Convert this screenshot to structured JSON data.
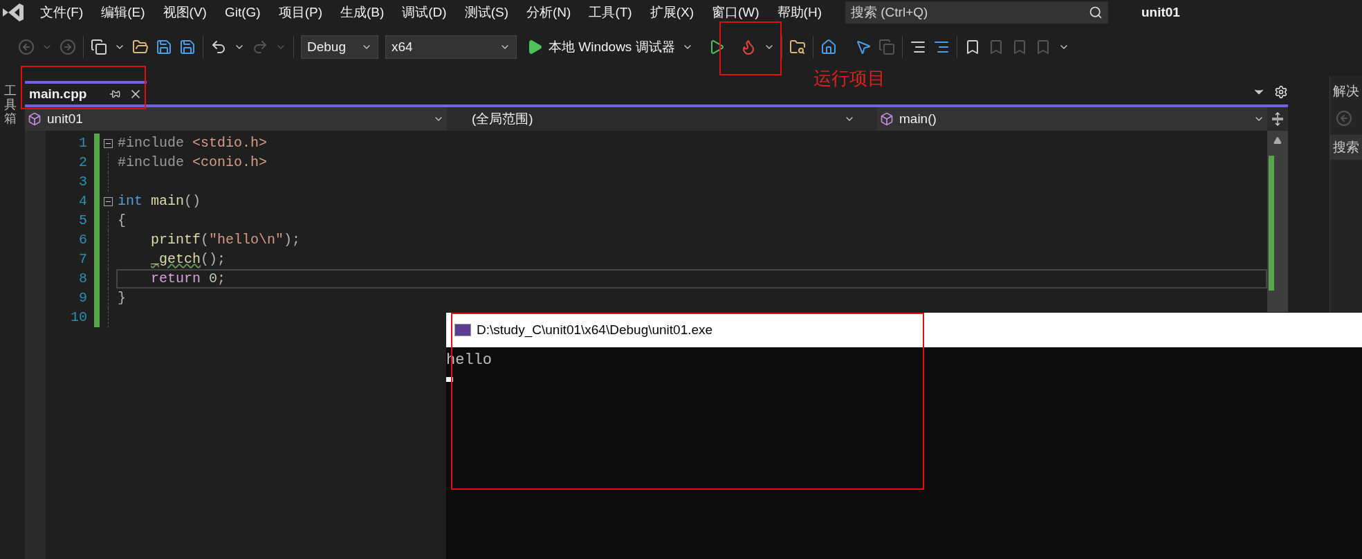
{
  "menu_bar": {
    "items": [
      "文件(F)",
      "编辑(E)",
      "视图(V)",
      "Git(G)",
      "项目(P)",
      "生成(B)",
      "调试(D)",
      "测试(S)",
      "分析(N)",
      "工具(T)",
      "扩展(X)",
      "窗口(W)",
      "帮助(H)"
    ],
    "search": {
      "placeholder": "搜索 (Ctrl+Q)"
    },
    "solution_name": "unit01"
  },
  "toolbar": {
    "configuration": "Debug",
    "platform": "x64",
    "run_button": "本地 Windows 调试器"
  },
  "annotation": {
    "label": "运行项目"
  },
  "left_strip": {
    "label": "工具箱"
  },
  "tabs": [
    {
      "label": "main.cpp",
      "selected": true
    }
  ],
  "navigation_bar": {
    "project": "unit01",
    "scope": "(全局范围)",
    "member": "main()"
  },
  "editor": {
    "lines": [
      {
        "number": "1",
        "collapse": true,
        "indented": false,
        "current": false,
        "tokens": [
          {
            "text": "#include",
            "kind": "preproc"
          },
          {
            "text": " <stdio.h>",
            "kind": "header"
          }
        ]
      },
      {
        "number": "2",
        "collapse": false,
        "indented": false,
        "current": false,
        "tokens": [
          {
            "text": "#include",
            "kind": "preproc"
          },
          {
            "text": " <conio.h>",
            "kind": "header"
          }
        ]
      },
      {
        "number": "3",
        "collapse": false,
        "current": false
      },
      {
        "number": "4",
        "collapse": true,
        "indented": false,
        "current": false,
        "tokens": [
          {
            "text": "int",
            "kind": "keyword"
          },
          {
            "text": " main",
            "kind": "function"
          },
          {
            "text": "()",
            "kind": "punct"
          }
        ]
      },
      {
        "number": "5",
        "collapse": false,
        "indented": false,
        "current": false,
        "tokens": [
          {
            "text": "{",
            "kind": "punct"
          }
        ]
      },
      {
        "number": "6",
        "collapse": false,
        "indented": true,
        "current": false,
        "tokens": [
          {
            "text": "printf",
            "kind": "function"
          },
          {
            "text": "(",
            "kind": "punct"
          },
          {
            "text": "\"hello\\n\"",
            "kind": "string"
          },
          {
            "text": ");",
            "kind": "punct"
          }
        ]
      },
      {
        "number": "7",
        "collapse": false,
        "indented": true,
        "current": false,
        "tokens": [
          {
            "text": "_getch",
            "kind": "squiggle"
          },
          {
            "text": "();",
            "kind": "punct"
          }
        ]
      },
      {
        "number": "8",
        "collapse": false,
        "indented": true,
        "current": true,
        "tokens": [
          {
            "text": "return",
            "kind": "control"
          },
          {
            "text": " 0",
            "kind": "number"
          },
          {
            "text": ";",
            "kind": "punct"
          }
        ]
      },
      {
        "number": "9",
        "collapse": false,
        "indented": false,
        "current": false,
        "tokens": [
          {
            "text": "}",
            "kind": "punct"
          }
        ]
      },
      {
        "number": "10",
        "collapse": false,
        "current": false
      }
    ]
  },
  "right_panel": {
    "title": "解决",
    "search": "搜索"
  },
  "console": {
    "title": "D:\\study_C\\unit01\\x64\\Debug\\unit01.exe",
    "output": "hello"
  }
}
